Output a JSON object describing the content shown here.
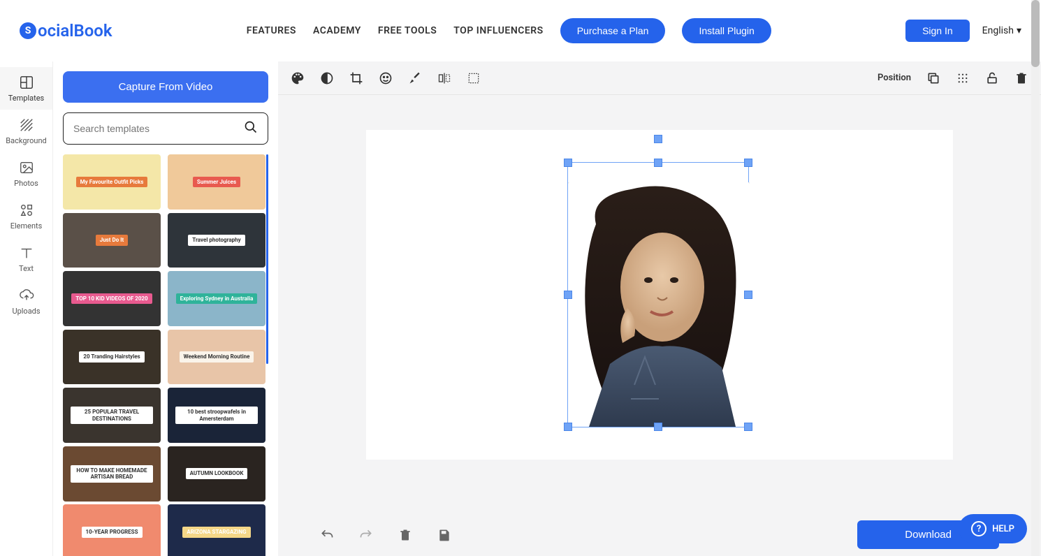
{
  "header": {
    "logo_text": "ocialBook",
    "logo_letter": "S",
    "nav": [
      "FEATURES",
      "ACADEMY",
      "FREE TOOLS",
      "TOP INFLUENCERS"
    ],
    "purchase": "Purchase a Plan",
    "install": "Install Plugin",
    "signin": "Sign In",
    "language": "English"
  },
  "sidebar": {
    "items": [
      {
        "label": "Templates"
      },
      {
        "label": "Background"
      },
      {
        "label": "Photos"
      },
      {
        "label": "Elements"
      },
      {
        "label": "Text"
      },
      {
        "label": "Uploads"
      }
    ]
  },
  "panel": {
    "capture": "Capture From Video",
    "search_placeholder": "Search templates",
    "templates": [
      {
        "title": "My Favourite Outfit Picks",
        "bg": "#f4e7a8",
        "accent": "#e77a3c"
      },
      {
        "title": "Summer Juices",
        "bg": "#f0c99a",
        "accent": "#e85a4f"
      },
      {
        "title": "Just Do It",
        "bg": "#5a5048",
        "accent": "#e77a3c"
      },
      {
        "title": "Travel photography",
        "bg": "#2e343a",
        "accent": "#fff"
      },
      {
        "title": "TOP 10 KID VIDEOS OF 2020",
        "bg": "#333",
        "accent": "#e85a8f"
      },
      {
        "title": "Exploring Sydney in Australia",
        "bg": "#8bb5c9",
        "accent": "#2fb39a"
      },
      {
        "title": "20 Tranding Hairstyles",
        "bg": "#3a3228",
        "accent": "#fff"
      },
      {
        "title": "Weekend Morning Routine",
        "bg": "#e8c5a8",
        "accent": "#faf4ea"
      },
      {
        "title": "25 POPULAR TRAVEL DESTINATIONS",
        "bg": "#3a342e",
        "accent": "#fff"
      },
      {
        "title": "10 best stroopwafels in Amersterdam",
        "bg": "#1a2438",
        "accent": "#fff"
      },
      {
        "title": "HOW TO MAKE HOMEMADE ARTISAN BREAD",
        "bg": "#6b4a32",
        "accent": "#fff"
      },
      {
        "title": "AUTUMN LOOKBOOK",
        "bg": "#2a2420",
        "accent": "#fff"
      },
      {
        "title": "10-YEAR PROGRESS",
        "bg": "#f08a6e",
        "accent": "#fff"
      },
      {
        "title": "ARIZONA STARGAZING",
        "bg": "#1e2a4a",
        "accent": "#f5d788"
      }
    ]
  },
  "toolbar": {
    "position": "Position"
  },
  "bottom": {
    "download": "Download"
  },
  "help": "HELP"
}
